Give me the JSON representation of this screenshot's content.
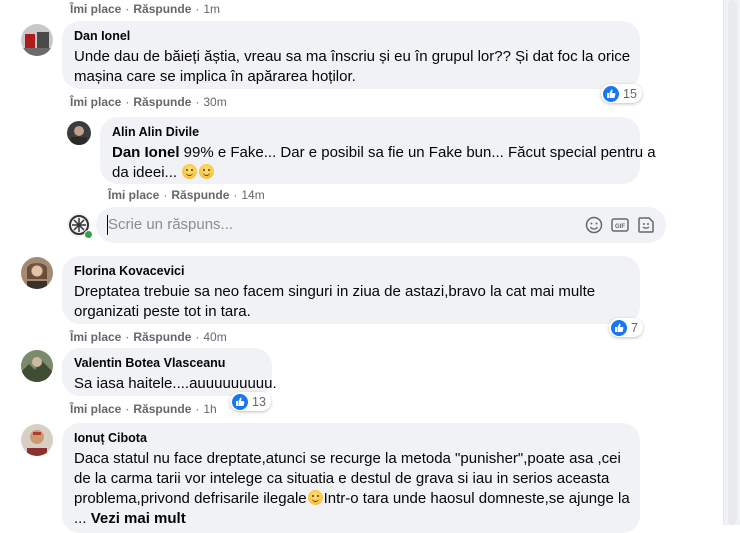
{
  "labels": {
    "like": "Îmi place",
    "reply": "Răspunde",
    "separator": "·"
  },
  "comments": [
    {
      "time": "1m"
    },
    {
      "author": "Dan Ionel",
      "text_line1": "Unde dau de băieți ăștia, vreau sa ma înscriu și eu în grupul lor?? Și dat foc la orice",
      "text_line2": "mașina care se implica în apărarea hoților.",
      "time": "30m",
      "reactions": "15",
      "reaction_type": "like-icon"
    },
    {
      "author": "Alin Alin Divile",
      "mention": "Dan Ionel",
      "text_line1": " 99% e Fake... Dar e posibil sa fie un Fake bun... Făcut special pentru a",
      "text_line2": "da ideei...",
      "time": "14m"
    },
    {
      "author": "Florina Kovacevici",
      "text_line1": "Dreptatea trebuie sa neo facem singuri in ziua de astazi,bravo la cat mai multe",
      "text_line2": "organizati peste tot in tara.",
      "time": "40m",
      "reactions": "7",
      "reaction_type": "like-icon"
    },
    {
      "author": "Valentin Botea Vlasceanu",
      "text_line1": "Sa iasa haitele....auuuuuuuuu.",
      "time": "1h",
      "reactions": "13",
      "reaction_type": "like-icon"
    },
    {
      "author": "Ionuț Cibota",
      "text_line1": "Daca statul nu face dreptate,atunci se recurge la metoda \"punisher\",poate asa ,cei",
      "text_line2": "de la carma tarii vor intelege ca situatia e destul de grava si iau in serios aceasta",
      "text_line3a": "problema,privond defrisarile ilegale",
      "text_line3b": "Intr-o tara unde haosul domneste,se ajunge la",
      "text_line4": "...",
      "see_more": "Vezi mai mult"
    }
  ],
  "reply_box": {
    "placeholder": "Scrie un răspuns..."
  },
  "colors": {
    "bubble": "#f0f2f5",
    "meta": "#65676b",
    "like_blue": "#1877f2"
  }
}
